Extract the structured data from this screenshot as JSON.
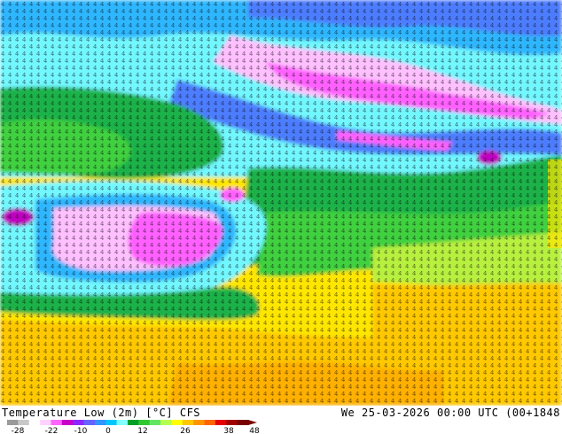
{
  "title": "Temperature Low (2m) [°C] CFS",
  "timestamp": "We 25-03-2026 00:00 UTC (00+1848",
  "colorbar": {
    "ticks": [
      "-28",
      "-22",
      "-10",
      "0",
      "12",
      "26",
      "38",
      "48"
    ],
    "colors": [
      "#9a9a9a",
      "#c8c8c8",
      "#ffffff",
      "#ffd2ff",
      "#ff64ff",
      "#c800c8",
      "#8c28ff",
      "#6464ff",
      "#3296ff",
      "#00c8ff",
      "#82ffff",
      "#00a028",
      "#32c832",
      "#64e664",
      "#b4ff50",
      "#ffff00",
      "#ffc800",
      "#ff9600",
      "#ff6400",
      "#e60000",
      "#a00000",
      "#780000"
    ]
  },
  "map_colors": {
    "deep_cold": "#c000c0",
    "magenta": "#ff60ff",
    "pink": "#ffc0ff",
    "blue": "#4d7dff",
    "light_blue": "#2fb6ff",
    "cyan": "#72f7ff",
    "green": "#1fb24a",
    "bright_green": "#40d040",
    "yellow_green": "#b8f040",
    "yellow": "#ffe600",
    "orange": "#ffc800"
  }
}
